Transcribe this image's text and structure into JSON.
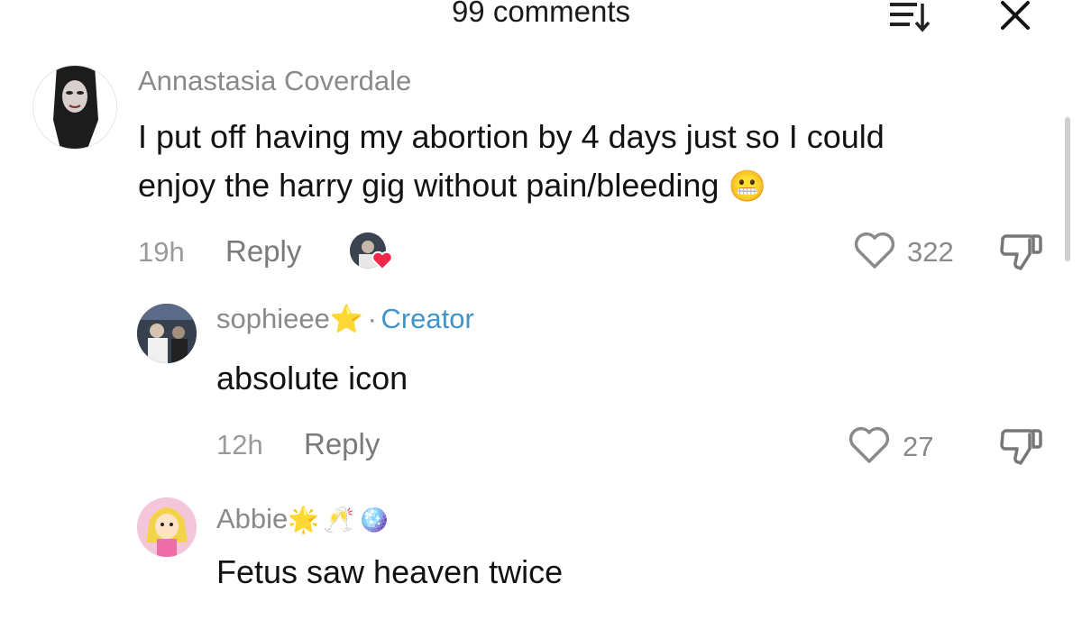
{
  "header": {
    "title": "99 comments"
  },
  "comments": [
    {
      "username": "Annastasia Coverdale",
      "text_line1": "I put off having my abortion by 4 days just so I could",
      "text_line2": "enjoy the harry gig without pain/bleeding",
      "emoji": "😬",
      "time": "19h",
      "reply_label": "Reply",
      "likes": "322"
    },
    {
      "username": "sophieee",
      "username_emoji": "⭐",
      "separator": "·",
      "creator_badge": "Creator",
      "text": "absolute icon",
      "time": "12h",
      "reply_label": "Reply",
      "likes": "27"
    },
    {
      "username": "Abbie",
      "username_emojis": "🌟🥂🪩",
      "text": "Fetus saw heaven twice"
    }
  ]
}
